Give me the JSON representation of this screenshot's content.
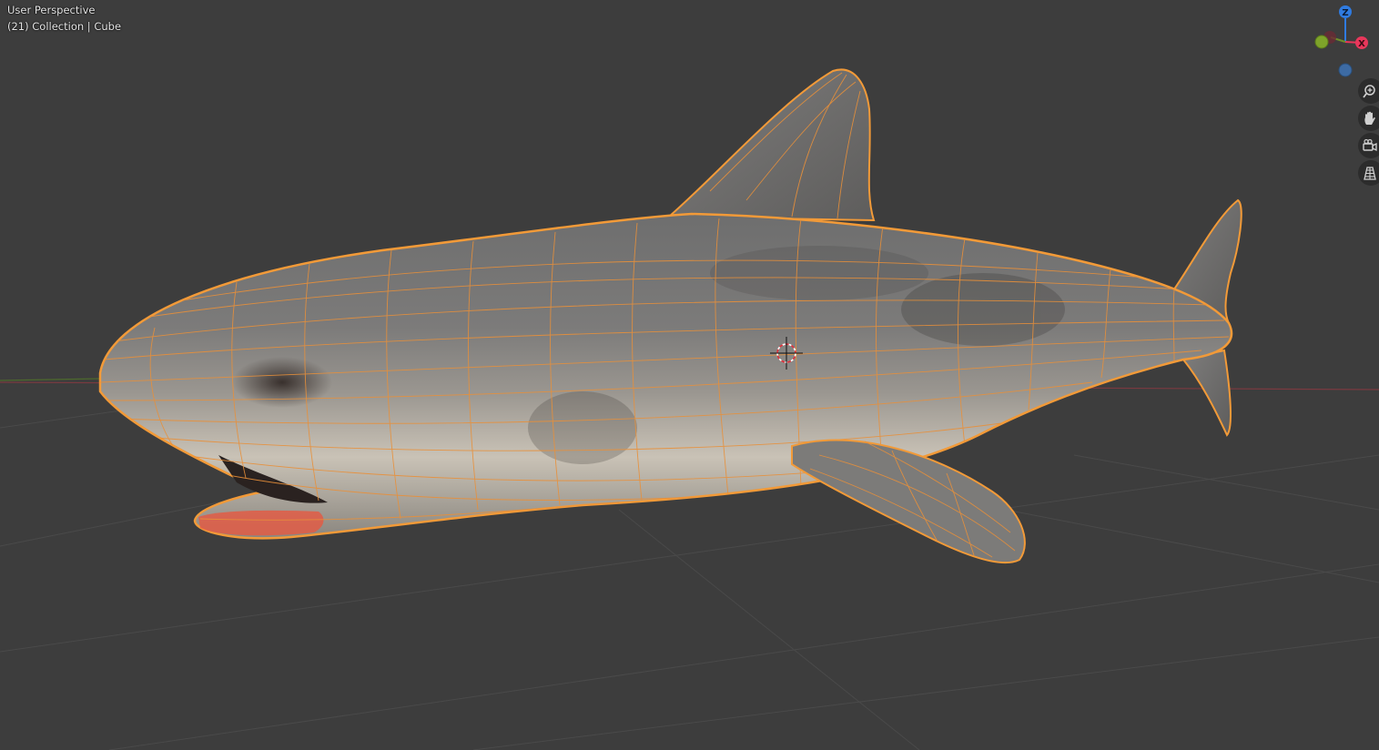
{
  "viewport": {
    "view_name": "User Perspective",
    "collection_info": "(21) Collection | Cube"
  },
  "gizmo": {
    "axis_z": "Z",
    "axis_x": "X",
    "colors": {
      "x": "#e8375b",
      "y": "#7ea32a",
      "z": "#2f7be0",
      "neg_z": "#3d6ba4"
    }
  },
  "nav_buttons": [
    {
      "name": "zoom",
      "icon": "zoom-icon"
    },
    {
      "name": "pan",
      "icon": "hand-icon"
    },
    {
      "name": "camera",
      "icon": "camera-icon"
    },
    {
      "name": "ortho",
      "icon": "grid-icon"
    }
  ],
  "colors": {
    "background": "#3d3d3d",
    "selection_outline": "#f29a38",
    "mesh_wire": "#e8903a"
  }
}
